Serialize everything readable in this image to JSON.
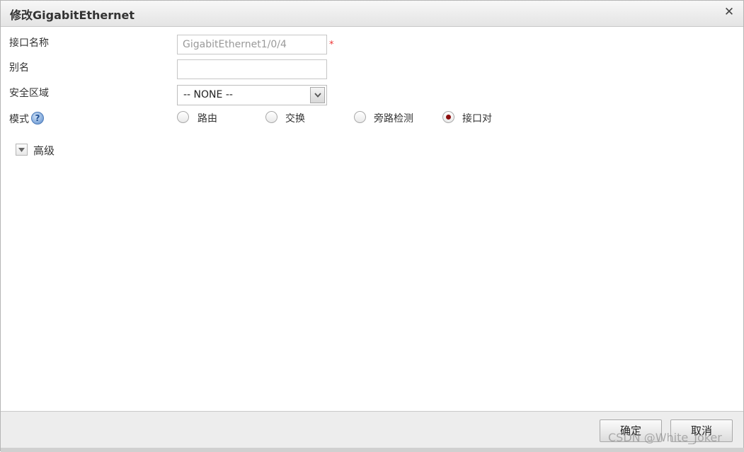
{
  "dialog": {
    "title": "修改GigabitEthernet",
    "close_glyph": "✕"
  },
  "form": {
    "interface_name": {
      "label": "接口名称",
      "value": "GigabitEthernet1/0/4",
      "required_mark": "*"
    },
    "alias": {
      "label": "别名",
      "value": ""
    },
    "security_zone": {
      "label": "安全区域",
      "selected": "-- NONE --"
    },
    "mode": {
      "label": "模式",
      "help_glyph": "?",
      "options": [
        {
          "label": "路由",
          "checked": false
        },
        {
          "label": "交换",
          "checked": false
        },
        {
          "label": "旁路检测",
          "checked": false
        },
        {
          "label": "接口对",
          "checked": true
        }
      ]
    },
    "advanced": {
      "label": "高级",
      "expanded": false
    }
  },
  "footer": {
    "ok_label": "确定",
    "cancel_label": "取消"
  },
  "watermark": "CSDN @White_Joker",
  "icons": {
    "close": "close-icon",
    "help": "help-icon",
    "dropdown": "chevron-down-icon",
    "advanced_toggle": "triangle-down-icon"
  }
}
